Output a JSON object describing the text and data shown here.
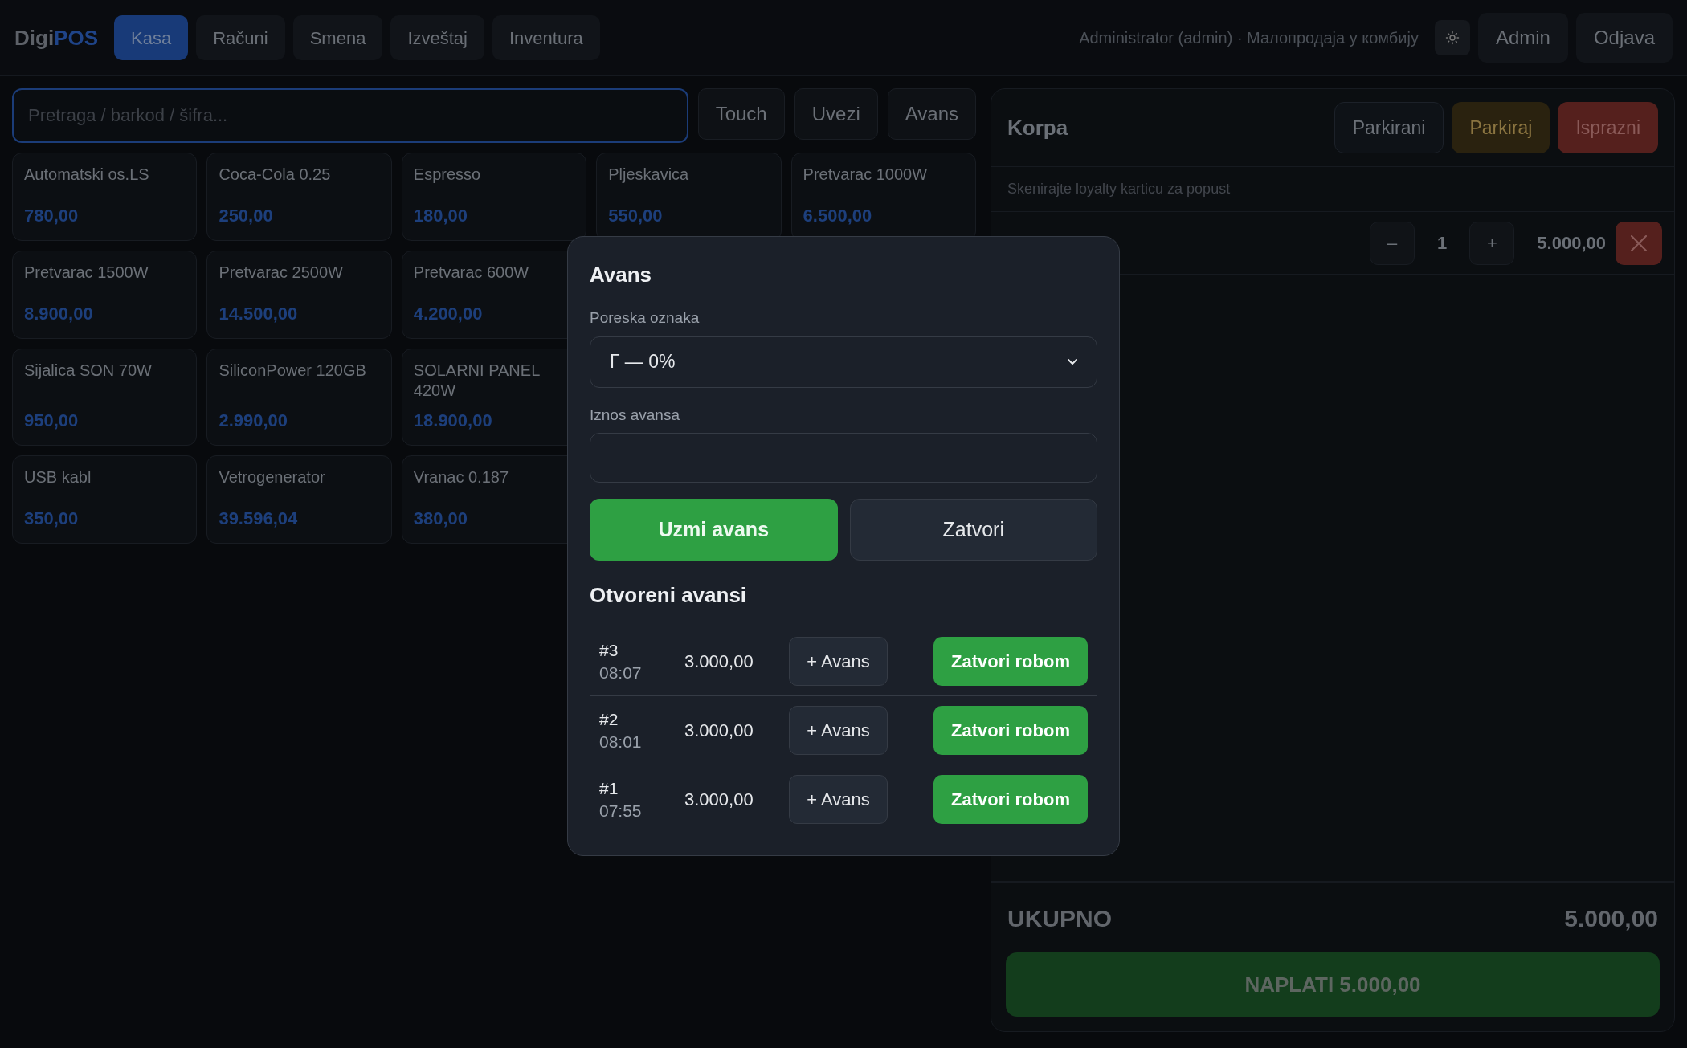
{
  "topbar": {
    "logo": {
      "first": "Digi",
      "second": "POS"
    },
    "tabs": [
      {
        "label": "Kasa",
        "selected": true
      },
      {
        "label": "Računi",
        "selected": false
      },
      {
        "label": "Smena",
        "selected": false
      },
      {
        "label": "Izveštaj",
        "selected": false
      },
      {
        "label": "Inventura",
        "selected": false
      }
    ],
    "user_info": "Administrator (admin) · Малопродаја у комбију",
    "buttons": [
      "Admin",
      "Odjava"
    ]
  },
  "search": {
    "placeholder": "Pretraga / barkod / šifra...",
    "focused": true,
    "buttons": [
      "Touch",
      "Uvezi",
      "Avans"
    ]
  },
  "product_rows": [
    [
      {
        "name": "Automatski os.LS",
        "price": "780,00"
      },
      {
        "name": "Coca-Cola 0.25",
        "price": "250,00"
      },
      {
        "name": "Espresso",
        "price": "180,00"
      },
      {
        "name": "Pljeskavica",
        "price": "550,00"
      },
      {
        "name": "Pretvarac 1000W",
        "price": "6.500,00"
      }
    ],
    [
      {
        "name": "Pretvarac 1500W",
        "price": "8.900,00"
      },
      {
        "name": "Pretvarac 2500W",
        "price": "14.500,00"
      },
      {
        "name": "Pretvarac 600W",
        "price": "4.200,00"
      }
    ],
    [
      {
        "name": "Sijalica SON 70W",
        "price": "950,00"
      },
      {
        "name": "SiliconPower 120GB",
        "price": "2.990,00"
      },
      {
        "name": "SOLARNI PANEL 420W",
        "price": "18.900,00"
      }
    ],
    [
      {
        "name": "USB kabl",
        "price": "350,00"
      },
      {
        "name": "Vetrogenerator",
        "price": "39.596,04"
      },
      {
        "name": "Vranac 0.187",
        "price": "380,00"
      }
    ]
  ],
  "cart": {
    "title": "Korpa",
    "buttons": [
      {
        "label": "Parkirani",
        "kind": "neutral"
      },
      {
        "label": "Parkiraj",
        "kind": "warning"
      },
      {
        "label": "Isprazni",
        "kind": "danger"
      }
    ],
    "loyalty_hint": "Skenirajte loyalty karticu za popust",
    "items": [
      {
        "decrement": "–",
        "quantity": "1",
        "increment": "+",
        "total": "5.000,00"
      }
    ],
    "total_label": "UKUPNO",
    "total": "5.000,00",
    "pay_button": "NAPLATI 5.000,00"
  },
  "dialog": {
    "title": "Avans",
    "tax_label": "Poreska oznaka",
    "tax_value": "Г — 0%",
    "amount_label": "Iznos avansa",
    "primary_button": "Uzmi avans",
    "secondary_button": "Zatvori",
    "open_title": "Otvoreni avansi",
    "open_advances": [
      {
        "number": "#3",
        "time": "08:07",
        "amount": "3.000,00",
        "add_button": "+ Avans",
        "close_button": "Zatvori robom"
      },
      {
        "number": "#2",
        "time": "08:01",
        "amount": "3.000,00",
        "add_button": "+ Avans",
        "close_button": "Zatvori robom"
      },
      {
        "number": "#1",
        "time": "07:55",
        "amount": "3.000,00",
        "add_button": "+ Avans",
        "close_button": "Zatvori robom"
      }
    ]
  }
}
